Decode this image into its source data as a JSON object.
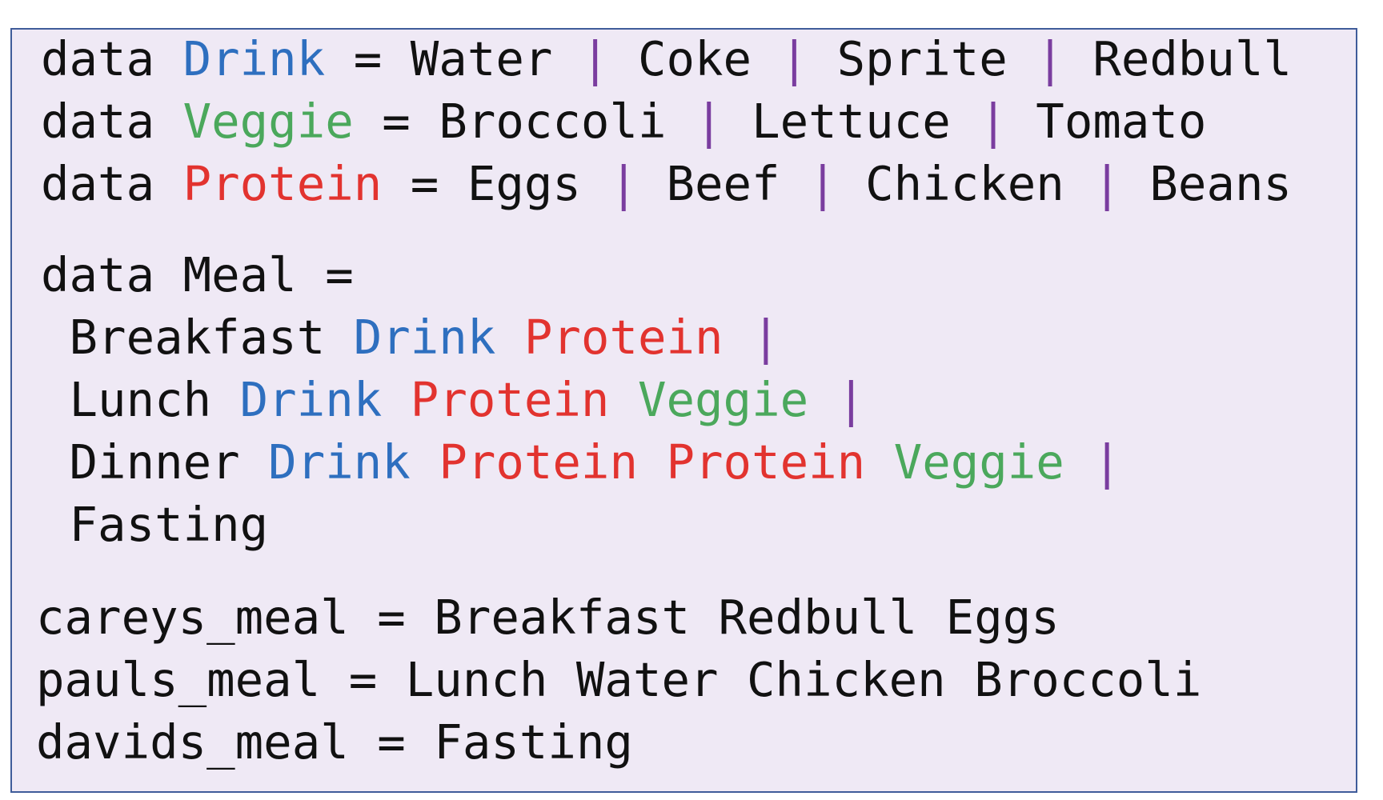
{
  "colors": {
    "background": "#EFE9F5",
    "border": "#3F5C9A",
    "text": "#111111",
    "drink": "#2E6FBF",
    "veggie": "#4BA85C",
    "protein": "#E2332F",
    "pipe": "#7A3D9F"
  },
  "lines": [
    {
      "name": "data-drink-line",
      "tokens": [
        {
          "text": "data ",
          "kind": "plain"
        },
        {
          "text": "Drink",
          "kind": "drink"
        },
        {
          "text": " = Water ",
          "kind": "plain"
        },
        {
          "text": "|",
          "kind": "pipe"
        },
        {
          "text": " Coke ",
          "kind": "plain"
        },
        {
          "text": "|",
          "kind": "pipe"
        },
        {
          "text": " Sprite ",
          "kind": "plain"
        },
        {
          "text": "|",
          "kind": "pipe"
        },
        {
          "text": " Redbull",
          "kind": "plain"
        }
      ]
    },
    {
      "name": "data-veggie-line",
      "tokens": [
        {
          "text": "data ",
          "kind": "plain"
        },
        {
          "text": "Veggie",
          "kind": "veggie"
        },
        {
          "text": " = Broccoli ",
          "kind": "plain"
        },
        {
          "text": "|",
          "kind": "pipe"
        },
        {
          "text": " Lettuce ",
          "kind": "plain"
        },
        {
          "text": "|",
          "kind": "pipe"
        },
        {
          "text": " Tomato",
          "kind": "plain"
        }
      ]
    },
    {
      "name": "data-protein-line",
      "tokens": [
        {
          "text": "data ",
          "kind": "plain"
        },
        {
          "text": "Protein",
          "kind": "protein"
        },
        {
          "text": " = Eggs ",
          "kind": "plain"
        },
        {
          "text": "|",
          "kind": "pipe"
        },
        {
          "text": " Beef ",
          "kind": "plain"
        },
        {
          "text": "|",
          "kind": "pipe"
        },
        {
          "text": " Chicken ",
          "kind": "plain"
        },
        {
          "text": "|",
          "kind": "pipe"
        },
        {
          "text": " Beans",
          "kind": "plain"
        }
      ]
    },
    {
      "name": "data-meal-line",
      "tokens": [
        {
          "text": "data Meal =",
          "kind": "plain"
        }
      ]
    },
    {
      "name": "breakfast-line",
      "tokens": [
        {
          "text": " Breakfast ",
          "kind": "plain"
        },
        {
          "text": "Drink",
          "kind": "drink"
        },
        {
          "text": " ",
          "kind": "plain"
        },
        {
          "text": "Protein",
          "kind": "protein"
        },
        {
          "text": " ",
          "kind": "plain"
        },
        {
          "text": "|",
          "kind": "pipe"
        }
      ]
    },
    {
      "name": "lunch-line",
      "tokens": [
        {
          "text": " Lunch ",
          "kind": "plain"
        },
        {
          "text": "Drink",
          "kind": "drink"
        },
        {
          "text": " ",
          "kind": "plain"
        },
        {
          "text": "Protein",
          "kind": "protein"
        },
        {
          "text": " ",
          "kind": "plain"
        },
        {
          "text": "Veggie",
          "kind": "veggie"
        },
        {
          "text": " ",
          "kind": "plain"
        },
        {
          "text": "|",
          "kind": "pipe"
        }
      ]
    },
    {
      "name": "dinner-line",
      "tokens": [
        {
          "text": " Dinner ",
          "kind": "plain"
        },
        {
          "text": "Drink",
          "kind": "drink"
        },
        {
          "text": " ",
          "kind": "plain"
        },
        {
          "text": "Protein",
          "kind": "protein"
        },
        {
          "text": " ",
          "kind": "plain"
        },
        {
          "text": "Protein",
          "kind": "protein"
        },
        {
          "text": " ",
          "kind": "plain"
        },
        {
          "text": "Veggie",
          "kind": "veggie"
        },
        {
          "text": " ",
          "kind": "plain"
        },
        {
          "text": "|",
          "kind": "pipe"
        }
      ]
    },
    {
      "name": "fasting-line",
      "tokens": [
        {
          "text": " Fasting",
          "kind": "plain"
        }
      ]
    },
    {
      "name": "careys-meal-line",
      "tokens": [
        {
          "text": "careys_meal = Breakfast Redbull Eggs",
          "kind": "plain"
        }
      ]
    },
    {
      "name": "pauls-meal-line",
      "tokens": [
        {
          "text": "pauls_meal = Lunch Water Chicken Broccoli",
          "kind": "plain"
        }
      ]
    },
    {
      "name": "davids-meal-line",
      "tokens": [
        {
          "text": "davids_meal = Fasting",
          "kind": "plain"
        }
      ]
    }
  ]
}
